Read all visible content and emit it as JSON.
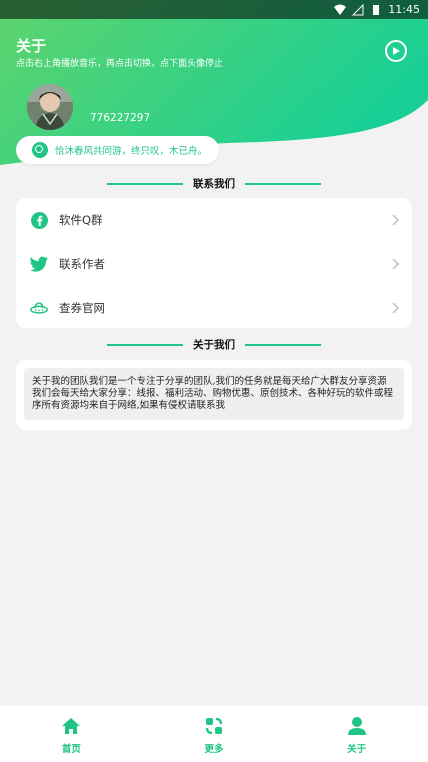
{
  "colors": {
    "accent": "#20c586",
    "header_start": "#57d370",
    "header_end": "#1ccf93",
    "background": "#f1f2f1"
  },
  "status_bar": {
    "time": "11:45",
    "icons": [
      "wifi-icon",
      "signal-icon",
      "battery-icon"
    ]
  },
  "header": {
    "title": "关于",
    "subtitle": "点击右上角播放音乐，再点击切换，点下面头像停止",
    "play_icon": "play-circle-icon"
  },
  "profile": {
    "qq": "776227297",
    "motto": "恰沐春风共同游，终只叹，木已舟。"
  },
  "contact_section": {
    "title": "联系我们",
    "items": [
      {
        "label": "软件Q群",
        "icon": "facebook-icon"
      },
      {
        "label": "联系作者",
        "icon": "twitter-icon"
      },
      {
        "label": "查券官网",
        "icon": "ufo-icon"
      }
    ]
  },
  "about_section": {
    "title": "关于我们",
    "text": "关于我的团队我们是一个专注于分享的团队,我们的任务就是每天给广大群友分享资源我们会每天给大家分享：线报、福利活动、购物优惠、原创技术、各种好玩的软件或程序所有资源均来自于网络,如果有侵权请联系我"
  },
  "tabbar": {
    "tabs": [
      {
        "label": "首页",
        "icon": "home-icon"
      },
      {
        "label": "更多",
        "icon": "more-icon"
      },
      {
        "label": "关于",
        "icon": "user-icon"
      }
    ]
  }
}
